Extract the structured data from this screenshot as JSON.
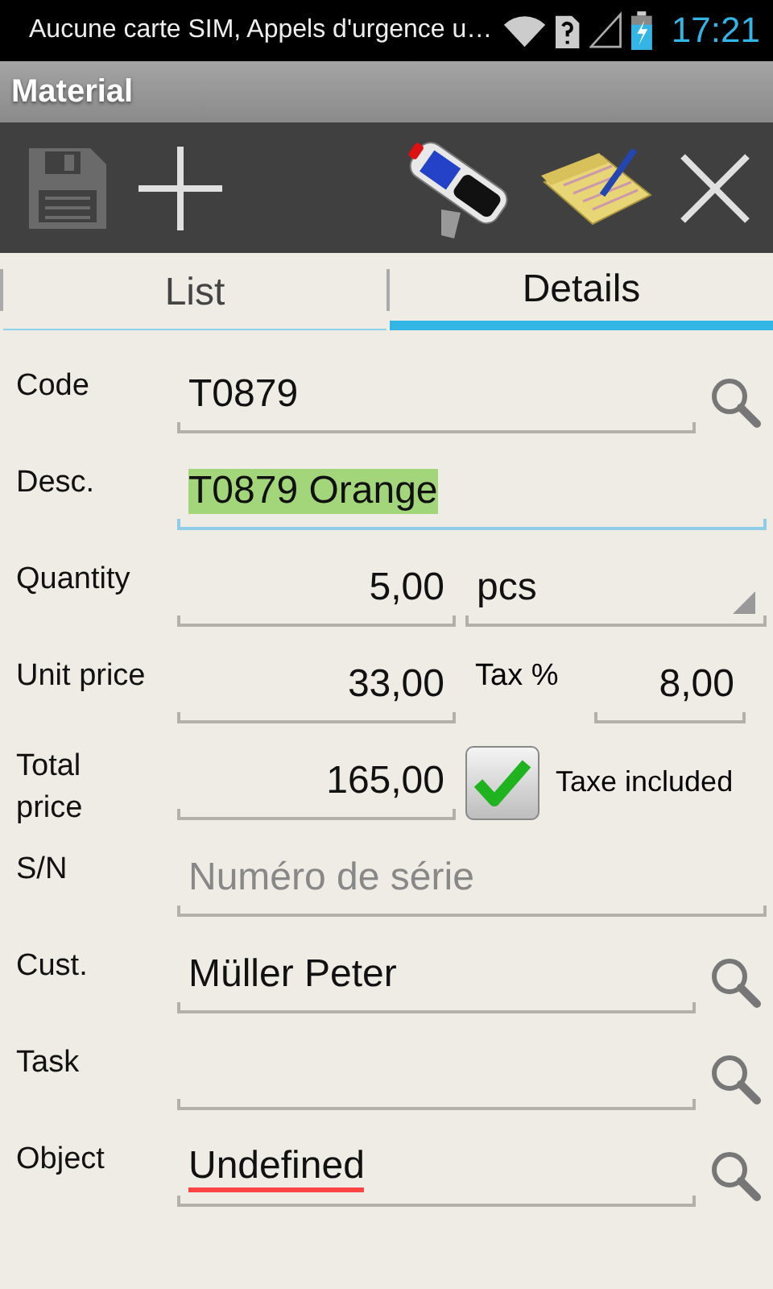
{
  "status_bar": {
    "notification": "Aucune carte SIM, Appels d'urgence u…",
    "time": "17:21"
  },
  "window": {
    "title": "Material"
  },
  "toolbar": [
    {
      "kind": "save",
      "disabled": true
    },
    {
      "kind": "add",
      "disabled": false
    },
    {
      "kind": "scanner",
      "disabled": false
    },
    {
      "kind": "notes",
      "disabled": false
    },
    {
      "kind": "close",
      "disabled": false
    }
  ],
  "tabs": [
    {
      "label": "List",
      "selected": false
    },
    {
      "label": "Details",
      "selected": true
    }
  ],
  "fields": [
    {
      "kind": "text",
      "label": "Code",
      "value": "T0879",
      "lookup": true
    },
    {
      "kind": "text",
      "label": "Desc.",
      "value": "T0879 Orange",
      "lookup": false,
      "focused": true,
      "text_selected": true
    },
    {
      "kind": "quantity",
      "label": "Quantity",
      "value": "5,00",
      "unit": "pcs"
    },
    {
      "kind": "price",
      "label": "Unit price",
      "value": "33,00",
      "tax_label": "Tax %",
      "tax_value": "8,00"
    },
    {
      "kind": "total",
      "label": "Total price",
      "value": "165,00",
      "checkbox": {
        "label": "Taxe included",
        "checked": true
      }
    },
    {
      "kind": "text",
      "label": "S/N",
      "placeholder": "Numéro de série",
      "lookup": false
    },
    {
      "kind": "text",
      "label": "Cust.",
      "value": "Müller Peter",
      "lookup": true
    },
    {
      "kind": "text",
      "label": "Task",
      "lookup": true
    },
    {
      "kind": "text",
      "label": "Object",
      "value": "Undefined",
      "lookup": true,
      "misspelled": true
    }
  ]
}
